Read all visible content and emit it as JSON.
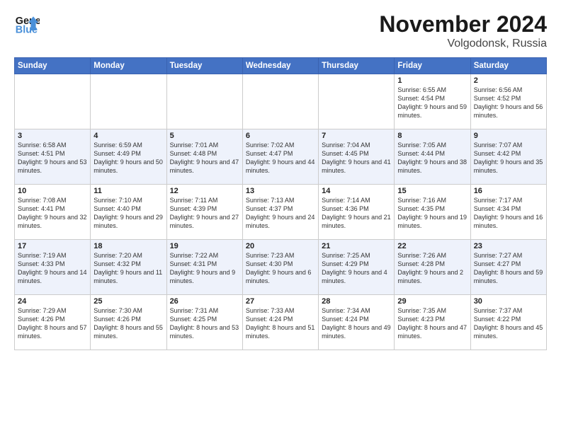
{
  "header": {
    "logo_line1": "General",
    "logo_line2": "Blue",
    "month": "November 2024",
    "location": "Volgodonsk, Russia"
  },
  "days_of_week": [
    "Sunday",
    "Monday",
    "Tuesday",
    "Wednesday",
    "Thursday",
    "Friday",
    "Saturday"
  ],
  "weeks": [
    [
      {
        "day": "",
        "info": ""
      },
      {
        "day": "",
        "info": ""
      },
      {
        "day": "",
        "info": ""
      },
      {
        "day": "",
        "info": ""
      },
      {
        "day": "",
        "info": ""
      },
      {
        "day": "1",
        "info": "Sunrise: 6:55 AM\nSunset: 4:54 PM\nDaylight: 9 hours and 59 minutes."
      },
      {
        "day": "2",
        "info": "Sunrise: 6:56 AM\nSunset: 4:52 PM\nDaylight: 9 hours and 56 minutes."
      }
    ],
    [
      {
        "day": "3",
        "info": "Sunrise: 6:58 AM\nSunset: 4:51 PM\nDaylight: 9 hours and 53 minutes."
      },
      {
        "day": "4",
        "info": "Sunrise: 6:59 AM\nSunset: 4:49 PM\nDaylight: 9 hours and 50 minutes."
      },
      {
        "day": "5",
        "info": "Sunrise: 7:01 AM\nSunset: 4:48 PM\nDaylight: 9 hours and 47 minutes."
      },
      {
        "day": "6",
        "info": "Sunrise: 7:02 AM\nSunset: 4:47 PM\nDaylight: 9 hours and 44 minutes."
      },
      {
        "day": "7",
        "info": "Sunrise: 7:04 AM\nSunset: 4:45 PM\nDaylight: 9 hours and 41 minutes."
      },
      {
        "day": "8",
        "info": "Sunrise: 7:05 AM\nSunset: 4:44 PM\nDaylight: 9 hours and 38 minutes."
      },
      {
        "day": "9",
        "info": "Sunrise: 7:07 AM\nSunset: 4:42 PM\nDaylight: 9 hours and 35 minutes."
      }
    ],
    [
      {
        "day": "10",
        "info": "Sunrise: 7:08 AM\nSunset: 4:41 PM\nDaylight: 9 hours and 32 minutes."
      },
      {
        "day": "11",
        "info": "Sunrise: 7:10 AM\nSunset: 4:40 PM\nDaylight: 9 hours and 29 minutes."
      },
      {
        "day": "12",
        "info": "Sunrise: 7:11 AM\nSunset: 4:39 PM\nDaylight: 9 hours and 27 minutes."
      },
      {
        "day": "13",
        "info": "Sunrise: 7:13 AM\nSunset: 4:37 PM\nDaylight: 9 hours and 24 minutes."
      },
      {
        "day": "14",
        "info": "Sunrise: 7:14 AM\nSunset: 4:36 PM\nDaylight: 9 hours and 21 minutes."
      },
      {
        "day": "15",
        "info": "Sunrise: 7:16 AM\nSunset: 4:35 PM\nDaylight: 9 hours and 19 minutes."
      },
      {
        "day": "16",
        "info": "Sunrise: 7:17 AM\nSunset: 4:34 PM\nDaylight: 9 hours and 16 minutes."
      }
    ],
    [
      {
        "day": "17",
        "info": "Sunrise: 7:19 AM\nSunset: 4:33 PM\nDaylight: 9 hours and 14 minutes."
      },
      {
        "day": "18",
        "info": "Sunrise: 7:20 AM\nSunset: 4:32 PM\nDaylight: 9 hours and 11 minutes."
      },
      {
        "day": "19",
        "info": "Sunrise: 7:22 AM\nSunset: 4:31 PM\nDaylight: 9 hours and 9 minutes."
      },
      {
        "day": "20",
        "info": "Sunrise: 7:23 AM\nSunset: 4:30 PM\nDaylight: 9 hours and 6 minutes."
      },
      {
        "day": "21",
        "info": "Sunrise: 7:25 AM\nSunset: 4:29 PM\nDaylight: 9 hours and 4 minutes."
      },
      {
        "day": "22",
        "info": "Sunrise: 7:26 AM\nSunset: 4:28 PM\nDaylight: 9 hours and 2 minutes."
      },
      {
        "day": "23",
        "info": "Sunrise: 7:27 AM\nSunset: 4:27 PM\nDaylight: 8 hours and 59 minutes."
      }
    ],
    [
      {
        "day": "24",
        "info": "Sunrise: 7:29 AM\nSunset: 4:26 PM\nDaylight: 8 hours and 57 minutes."
      },
      {
        "day": "25",
        "info": "Sunrise: 7:30 AM\nSunset: 4:26 PM\nDaylight: 8 hours and 55 minutes."
      },
      {
        "day": "26",
        "info": "Sunrise: 7:31 AM\nSunset: 4:25 PM\nDaylight: 8 hours and 53 minutes."
      },
      {
        "day": "27",
        "info": "Sunrise: 7:33 AM\nSunset: 4:24 PM\nDaylight: 8 hours and 51 minutes."
      },
      {
        "day": "28",
        "info": "Sunrise: 7:34 AM\nSunset: 4:24 PM\nDaylight: 8 hours and 49 minutes."
      },
      {
        "day": "29",
        "info": "Sunrise: 7:35 AM\nSunset: 4:23 PM\nDaylight: 8 hours and 47 minutes."
      },
      {
        "day": "30",
        "info": "Sunrise: 7:37 AM\nSunset: 4:22 PM\nDaylight: 8 hours and 45 minutes."
      }
    ]
  ]
}
